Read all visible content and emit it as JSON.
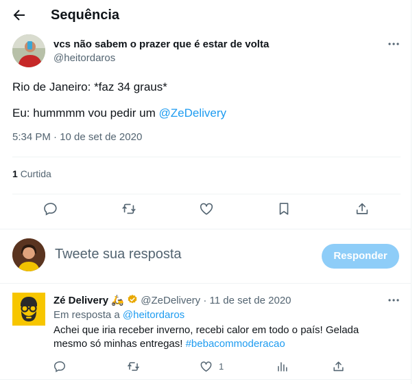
{
  "header": {
    "title": "Sequência"
  },
  "tweet": {
    "display_name": "vcs não sabem o prazer que é estar de volta",
    "handle": "@heitordaros",
    "line1": "Rio de Janeiro: *faz 34 graus*",
    "line2_prefix": "Eu: hummmm vou pedir um ",
    "line2_mention": "@ZeDelivery",
    "timestamp": "5:34 PM · 10 de set de 2020",
    "likes_count": "1",
    "likes_label": "Curtida"
  },
  "reply_composer": {
    "placeholder": "Tweete sua resposta",
    "button_label": "Responder"
  },
  "reply": {
    "display_name": "Zé Delivery",
    "emoji": "🛵",
    "handle": "@ZeDelivery",
    "separator": "·",
    "date": "11 de set de 2020",
    "in_reply_prefix": "Em resposta a ",
    "in_reply_handle": "@heitordaros",
    "text_line1": "Achei que iria receber inverno, recebi calor em todo o país! Gelada",
    "text_line2_prefix": "mesmo só minhas entregas! ",
    "hashtag": "#bebacommoderacao",
    "like_count": "1"
  },
  "colors": {
    "accent": "#1d9bf0",
    "reply_button": "#8ecdf8",
    "verified_badge": "#e8a800",
    "ze_brand": "#f7c600"
  },
  "icons": [
    "arrow-left-icon",
    "more-icon",
    "reply-icon",
    "retweet-icon",
    "heart-icon",
    "bookmark-icon",
    "share-icon",
    "verified-icon",
    "analytics-icon"
  ]
}
